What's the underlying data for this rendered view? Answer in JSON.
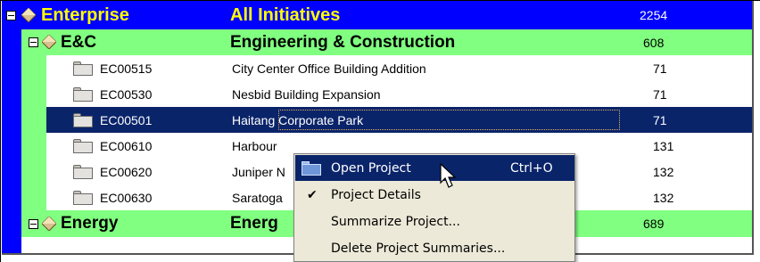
{
  "enterprise": {
    "code": "Enterprise",
    "name": "All Initiatives",
    "value": "2254"
  },
  "groups": [
    {
      "code": "E&C",
      "name": "Engineering & Construction",
      "value": "608"
    },
    {
      "code": "Energy",
      "name": "Energ",
      "value": "689"
    }
  ],
  "projects": [
    {
      "code": "EC00515",
      "name": "City Center Office Building Addition",
      "value": "71"
    },
    {
      "code": "EC00530",
      "name": "Nesbid Building Expansion",
      "value": "71"
    },
    {
      "code": "EC00501",
      "name": "Haitang Corporate Park",
      "value": "71"
    },
    {
      "code": "EC00610",
      "name": "Harbour",
      "value": "131"
    },
    {
      "code": "EC00620",
      "name": "Juniper N",
      "value": "132"
    },
    {
      "code": "EC00630",
      "name": "Saratoga",
      "value": "132"
    }
  ],
  "selected_project": "EC00501",
  "context_menu": {
    "items": [
      {
        "label": "Open Project",
        "shortcut": "Ctrl+O",
        "icon": "open-folder-icon"
      },
      {
        "label": "Project Details",
        "shortcut": "",
        "icon": "check-icon"
      },
      {
        "label": "Summarize Project...",
        "shortcut": "",
        "icon": ""
      },
      {
        "label": "Delete Project Summaries...",
        "shortcut": "",
        "icon": ""
      }
    ]
  },
  "colors": {
    "enterprise_bg": "#0000ff",
    "enterprise_text": "#ffff00",
    "group_bg": "#80ff80",
    "selection_bg": "#0a246a",
    "menu_bg": "#ece9d8"
  }
}
